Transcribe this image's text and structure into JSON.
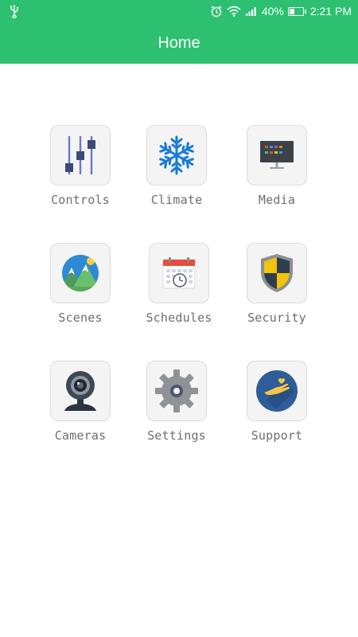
{
  "status_bar": {
    "icons": [
      "usb-icon",
      "alarm-icon",
      "wifi-icon",
      "signal-icon",
      "battery-icon"
    ],
    "battery_percent": "40%",
    "battery_level": 0.4,
    "time": "2:21 PM"
  },
  "app_bar": {
    "title": "Home"
  },
  "colors": {
    "accent": "#2cc070",
    "tile_bg": "#f4f4f4",
    "label": "#6e6e6e"
  },
  "tiles": [
    {
      "label": "Controls",
      "icon": "sliders-icon"
    },
    {
      "label": "Climate",
      "icon": "snowflake-icon"
    },
    {
      "label": "Media",
      "icon": "tv-icon"
    },
    {
      "label": "Scenes",
      "icon": "mountain-scene-icon"
    },
    {
      "label": "Schedules",
      "icon": "calendar-clock-icon"
    },
    {
      "label": "Security",
      "icon": "shield-icon"
    },
    {
      "label": "Cameras",
      "icon": "webcam-icon"
    },
    {
      "label": "Settings",
      "icon": "gear-icon"
    },
    {
      "label": "Support",
      "icon": "hand-support-icon"
    }
  ]
}
